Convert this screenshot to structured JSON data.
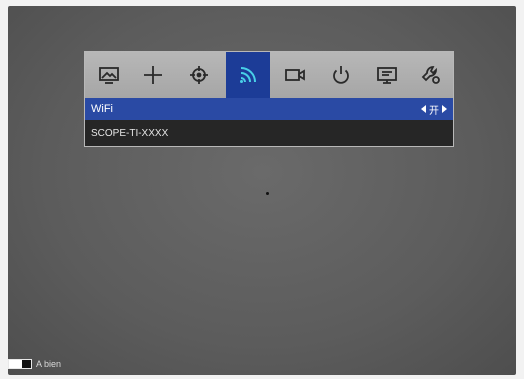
{
  "menu": {
    "icons": [
      {
        "name": "image-icon",
        "active": false
      },
      {
        "name": "crosshair-icon",
        "active": false
      },
      {
        "name": "focus-icon",
        "active": false
      },
      {
        "name": "wifi-icon",
        "active": true
      },
      {
        "name": "video-camera-icon",
        "active": false
      },
      {
        "name": "power-icon",
        "active": false
      },
      {
        "name": "display-icon",
        "active": false
      },
      {
        "name": "settings-icon",
        "active": false
      }
    ],
    "wifi_label": "WiFi",
    "wifi_value": "开",
    "ssid": "SCOPE-TI-XXXX"
  },
  "footer": {
    "text": "A bien"
  },
  "colors": {
    "active_icon_bg": "#1c3c97",
    "selected_row_bg": "#2a4aa4"
  }
}
